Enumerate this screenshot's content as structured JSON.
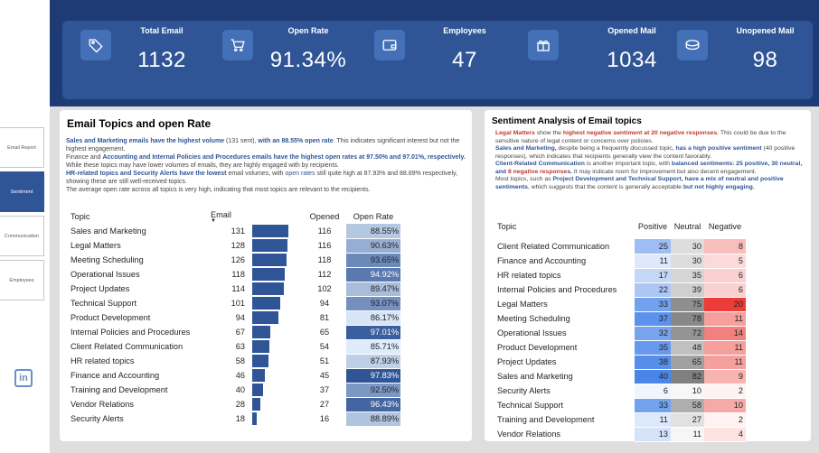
{
  "nav": {
    "items": [
      "Email Report",
      "Sentiment",
      "Communication",
      "Employees"
    ],
    "active": "Sentiment"
  },
  "kpis": [
    {
      "label": "Total Email",
      "value": "1132",
      "icon": "tag-icon"
    },
    {
      "label": "Open Rate",
      "value": "91.34%",
      "icon": "cart-icon"
    },
    {
      "label": "Employees",
      "value": "47",
      "icon": "wallet-icon"
    },
    {
      "label": "Opened Mail",
      "value": "1034",
      "icon": "gift-icon"
    },
    {
      "label": "Unopened Mail",
      "value": "98",
      "icon": "coins-icon"
    }
  ],
  "topics_panel": {
    "title": "Email Topics and open Rate",
    "columns": {
      "topic": "Topic",
      "email": "Email",
      "opened": "Opened",
      "open_rate": "Open Rate"
    },
    "rows": [
      {
        "topic": "Sales and Marketing",
        "email": 131,
        "opened": 116,
        "rate": "88.55%",
        "rate_value": 88.55
      },
      {
        "topic": "Legal Matters",
        "email": 128,
        "opened": 116,
        "rate": "90.63%",
        "rate_value": 90.63
      },
      {
        "topic": "Meeting Scheduling",
        "email": 126,
        "opened": 118,
        "rate": "93.65%",
        "rate_value": 93.65
      },
      {
        "topic": "Operational Issues",
        "email": 118,
        "opened": 112,
        "rate": "94.92%",
        "rate_value": 94.92
      },
      {
        "topic": "Project Updates",
        "email": 114,
        "opened": 102,
        "rate": "89.47%",
        "rate_value": 89.47
      },
      {
        "topic": "Technical Support",
        "email": 101,
        "opened": 94,
        "rate": "93.07%",
        "rate_value": 93.07
      },
      {
        "topic": "Product Development",
        "email": 94,
        "opened": 81,
        "rate": "86.17%",
        "rate_value": 86.17
      },
      {
        "topic": "Internal Policies and Procedures",
        "email": 67,
        "opened": 65,
        "rate": "97.01%",
        "rate_value": 97.01
      },
      {
        "topic": "Client Related Communication",
        "email": 63,
        "opened": 54,
        "rate": "85.71%",
        "rate_value": 85.71
      },
      {
        "topic": "HR related topics",
        "email": 58,
        "opened": 51,
        "rate": "87.93%",
        "rate_value": 87.93
      },
      {
        "topic": "Finance and Accounting",
        "email": 46,
        "opened": 45,
        "rate": "97.83%",
        "rate_value": 97.83
      },
      {
        "topic": "Training and Development",
        "email": 40,
        "opened": 37,
        "rate": "92.50%",
        "rate_value": 92.5
      },
      {
        "topic": "Vendor Relations",
        "email": 28,
        "opened": 27,
        "rate": "96.43%",
        "rate_value": 96.43
      },
      {
        "topic": "Security Alerts",
        "email": 18,
        "opened": 16,
        "rate": "88.89%",
        "rate_value": 88.89
      }
    ]
  },
  "topics_narrative": {
    "p1a": "Sales and Marketing emails have the highest volume",
    "p1b": " (131 sent), ",
    "p1c": "with an 88.55% open rate",
    "p1d": ". This indicates significant interest but not the highest engagement.",
    "p2a": "Finance and ",
    "p2b": "Accounting and Internal Policies and Procedures emails have the highest open rates at 97.50% and 97.01%, respectively.",
    "p2c": " While these topics may have lower volumes of emails, they are highly engaged with by recipients.",
    "p3a": "HR-related topics and Security Alerts have the lowest",
    "p3b": " email volumes, with ",
    "p3c": "open rates",
    "p3d": " still quite high at 87.93% and 88.89% respectively, showing these are still well-received topics.",
    "p4": "The average open rate across all topics is very high, indicating that most topics are relevant to the recipients."
  },
  "sentiment_panel": {
    "title": "Sentiment Analysis of Email topics",
    "columns": {
      "topic": "Topic",
      "positive": "Positive",
      "neutral": "Neutral",
      "negative": "Negative"
    },
    "rows": [
      {
        "topic": "Client Related Communication",
        "positive": 25,
        "neutral": 30,
        "negative": 8
      },
      {
        "topic": "Finance and Accounting",
        "positive": 11,
        "neutral": 30,
        "negative": 5
      },
      {
        "topic": "HR related topics",
        "positive": 17,
        "neutral": 35,
        "negative": 6
      },
      {
        "topic": "Internal Policies and Procedures",
        "positive": 22,
        "neutral": 39,
        "negative": 6
      },
      {
        "topic": "Legal Matters",
        "positive": 33,
        "neutral": 75,
        "negative": 20
      },
      {
        "topic": "Meeting Scheduling",
        "positive": 37,
        "neutral": 78,
        "negative": 11
      },
      {
        "topic": "Operational Issues",
        "positive": 32,
        "neutral": 72,
        "negative": 14
      },
      {
        "topic": "Product Development",
        "positive": 35,
        "neutral": 48,
        "negative": 11
      },
      {
        "topic": "Project Updates",
        "positive": 38,
        "neutral": 65,
        "negative": 11
      },
      {
        "topic": "Sales and Marketing",
        "positive": 40,
        "neutral": 82,
        "negative": 9
      },
      {
        "topic": "Security Alerts",
        "positive": 6,
        "neutral": 10,
        "negative": 2
      },
      {
        "topic": "Technical Support",
        "positive": 33,
        "neutral": 58,
        "negative": 10
      },
      {
        "topic": "Training and Development",
        "positive": 11,
        "neutral": 27,
        "negative": 2
      },
      {
        "topic": "Vendor Relations",
        "positive": 13,
        "neutral": 11,
        "negative": 4
      }
    ]
  },
  "sentiment_narrative": {
    "p1a": "Legal Matters",
    "p1b": " show the ",
    "p1c": "highest negative sentiment at 20 negative responses.",
    "p1d": " This could be due to the sensitive nature of legal content or concerns over policies.",
    "p2a": "Sales and Marketing,",
    "p2b": " despite being a frequently discussed topic, ",
    "p2c": "has a high positive sentiment",
    "p2d": " (40 positive responses), which indicates that recipients generally view the content favorably.",
    "p3a": "Client-Related Communication",
    "p3b": " is another important topic, with ",
    "p3c": "balanced sentiments: 25 positive, 30 neutral, and ",
    "p3d": "8 negative response",
    "p3e": "s.",
    "p3f": " It may indicate room for improvement but also decent engagement.",
    "p4a": "Most topics, such as ",
    "p4b": "Project Development and Technical Support, have a mix of neutral and positive sentiments",
    "p4c": ", which suggests that the content is generally acceptable ",
    "p4d": "but not highly engaging."
  },
  "colors": {
    "header": "#1f3b76",
    "kpi_strip": "#2f5597",
    "bar": "#2f5597",
    "accent_red": "#c0392b"
  }
}
